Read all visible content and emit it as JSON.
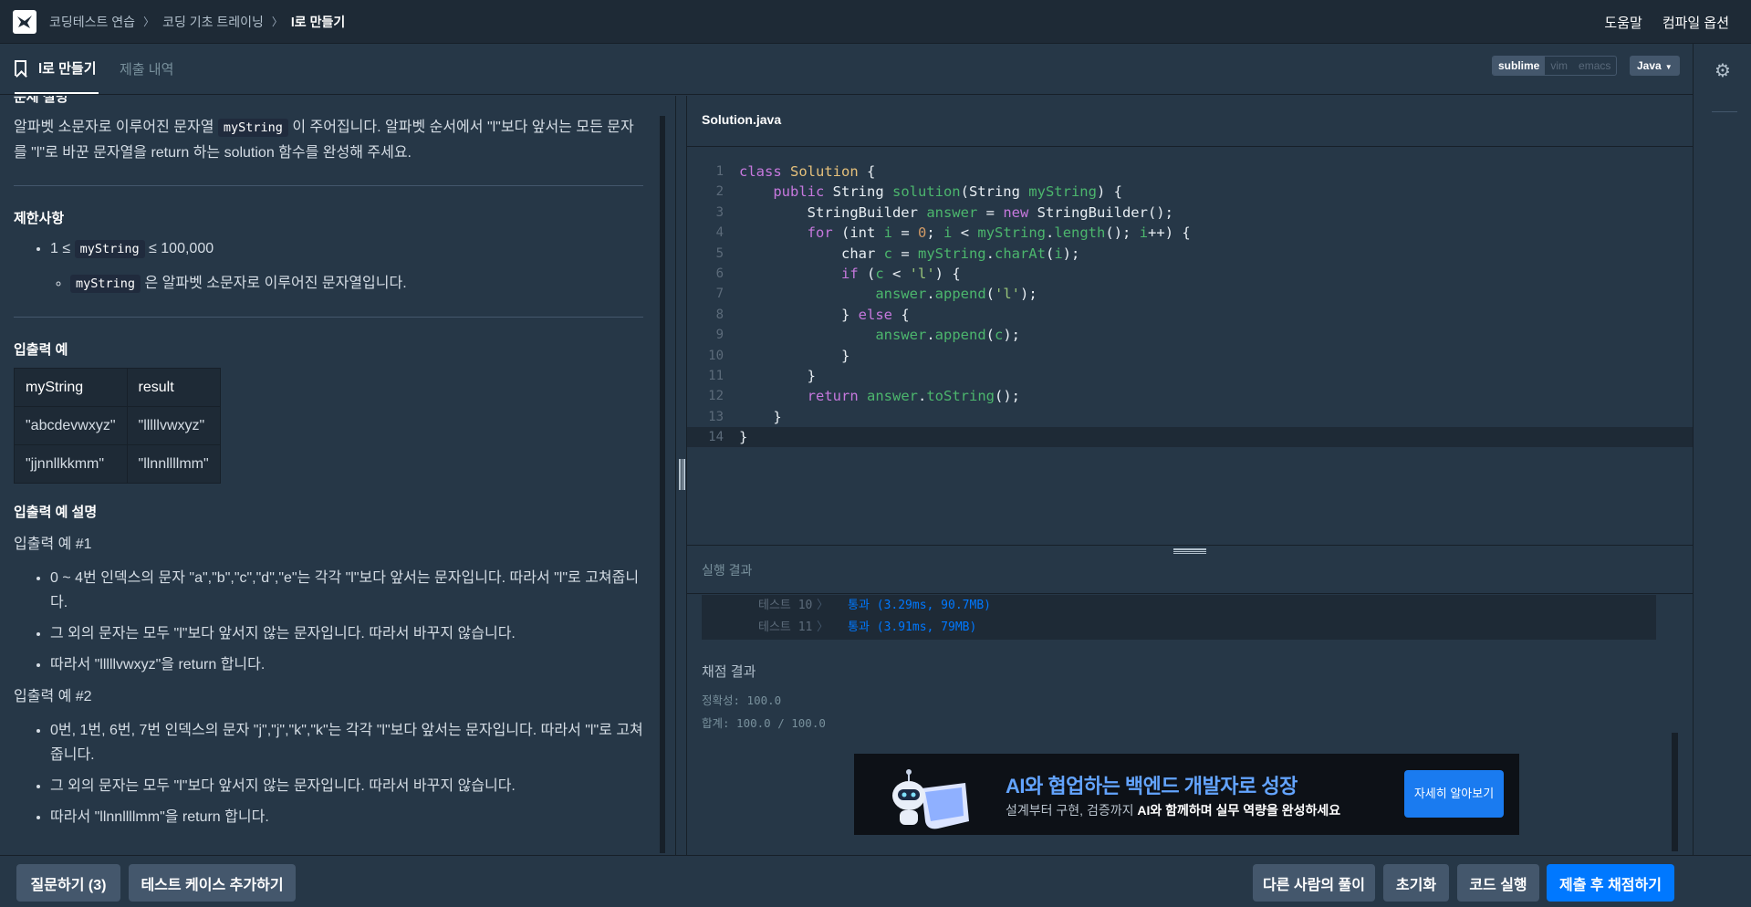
{
  "nav": {
    "breadcrumbs": [
      "코딩테스트 연습",
      "코딩 기초 트레이닝",
      "l로 만들기"
    ],
    "help": "도움말",
    "compile_options": "컴파일 옵션"
  },
  "tabs": {
    "problem": "l로 만들기",
    "submissions": "제출 내역"
  },
  "editor_modes": [
    "sublime",
    "vim",
    "emacs"
  ],
  "language": "Java",
  "description": {
    "section_title_partial": "문제 설명",
    "p_before": "알파벳 소문자로 이루어진 문자열 ",
    "p_code": "myString",
    "p_after": " 이 주어집니다. 알파벳 순서에서 \"l\"보다 앞서는 모든 문자를 \"l\"로 바꾼 문자열을 return 하는 solution 함수를 완성해 주세요.",
    "constraints_title": "제한사항",
    "c1_before": "1 ≤ ",
    "c1_code": "myString",
    "c1_after": " ≤ 100,000",
    "c2_code": "myString",
    "c2_after": " 은 알파벳 소문자로 이루어진 문자열입니다.",
    "io_title": "입출력 예",
    "table": {
      "headers": [
        "myString",
        "result"
      ],
      "rows": [
        [
          "\"abcdevwxyz\"",
          "\"lllllvwxyz\""
        ],
        [
          "\"jjnnllkkmm\"",
          "\"llnnllllmm\""
        ]
      ]
    },
    "io_explain_title": "입출력 예 설명",
    "ex1_title": "입출력 예 #1",
    "ex1_items": [
      "0 ~ 4번 인덱스의 문자 \"a\",\"b\",\"c\",\"d\",\"e\"는 각각 \"l\"보다 앞서는 문자입니다. 따라서 \"l\"로 고쳐줍니다.",
      "그 외의 문자는 모두 \"l\"보다 앞서지 않는 문자입니다. 따라서 바꾸지 않습니다.",
      "따라서 \"lllllvwxyz\"을 return 합니다."
    ],
    "ex2_title": "입출력 예 #2",
    "ex2_items": [
      "0번, 1번, 6번, 7번 인덱스의 문자 \"j\",\"j\",\"k\",\"k\"는 각각 \"l\"보다 앞서는 문자입니다. 따라서 \"l\"로 고쳐줍니다.",
      "그 외의 문자는 모두 \"l\"보다 앞서지 않는 문자입니다. 따라서 바꾸지 않습니다.",
      "따라서 \"llnnllllmm\"을 return 합니다."
    ]
  },
  "editor": {
    "filename": "Solution.java",
    "line_numbers": [
      "1",
      "2",
      "3",
      "4",
      "5",
      "6",
      "7",
      "8",
      "9",
      "10",
      "11",
      "12",
      "13",
      "14"
    ]
  },
  "results": {
    "title": "실행 결과",
    "tests": [
      {
        "name": "테스트 10",
        "sep": "〉",
        "result": "통과 (3.29ms, 90.7MB)"
      },
      {
        "name": "테스트 11",
        "sep": "〉",
        "result": "통과 (3.91ms, 79MB)"
      }
    ],
    "grading_title": "채점 결과",
    "accuracy": "정확성: 100.0",
    "total": "합계: 100.0 / 100.0"
  },
  "ad": {
    "title": "AI와 협업하는 백엔드 개발자로 성장",
    "sub_before": "설계부터 구현, 검증까지 ",
    "sub_bold": "AI와 함께하며 실무 역량을 완성하세요",
    "button": "자세히 알아보기"
  },
  "bottom": {
    "ask": "질문하기 (3)",
    "add_test": "테스트 케이스 추가하기",
    "others": "다른 사람의 풀이",
    "reset": "초기화",
    "run": "코드 실행",
    "submit": "제출 후 채점하기"
  },
  "colors": {
    "background": "#263747",
    "nav": "#1e2a36",
    "primary": "#0078ff",
    "button": "#44576c",
    "pass": "#0078ff"
  }
}
